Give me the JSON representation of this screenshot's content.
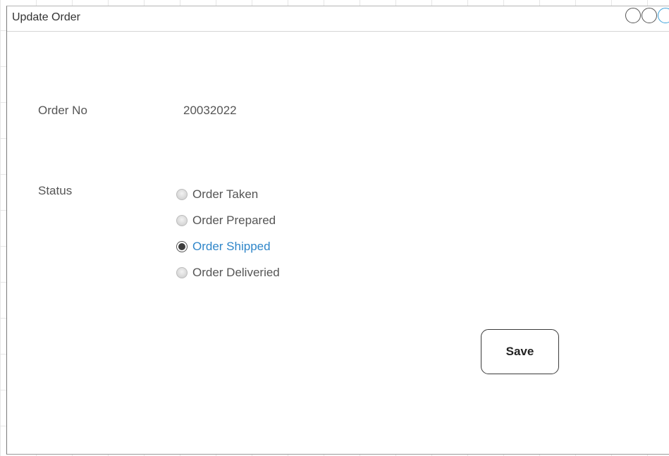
{
  "window": {
    "title": "Update Order"
  },
  "form": {
    "order_no_label": "Order No",
    "order_no_value": "20032022",
    "status_label": "Status",
    "status_options": [
      {
        "label": "Order Taken",
        "selected": false
      },
      {
        "label": "Order Prepared",
        "selected": false
      },
      {
        "label": "Order Shipped",
        "selected": true
      },
      {
        "label": "Order Deliveried",
        "selected": false
      }
    ],
    "save_label": "Save"
  },
  "colors": {
    "selected_text": "#2f86c9",
    "accent_control": "#3aa0d8"
  }
}
